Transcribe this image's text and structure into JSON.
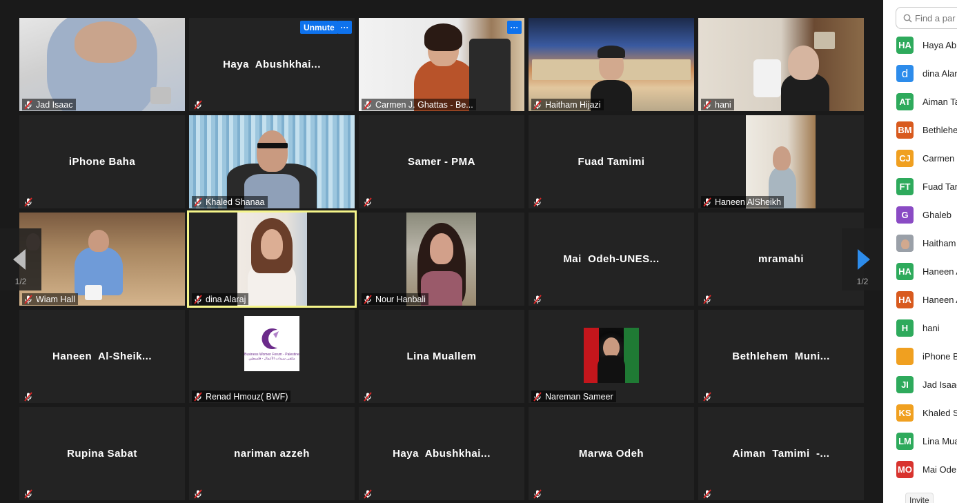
{
  "gallery": {
    "tiles": [
      {
        "name": "Jad Isaac",
        "center": ""
      },
      {
        "name": "",
        "center": "Haya  Abushkhai..."
      },
      {
        "name": "Carmen J. Ghattas - Be...",
        "center": ""
      },
      {
        "name": "Haitham Hijazi",
        "center": ""
      },
      {
        "name": "hani",
        "center": ""
      },
      {
        "name": "",
        "center": "iPhone Baha"
      },
      {
        "name": "Khaled Shanaa",
        "center": ""
      },
      {
        "name": "",
        "center": "Samer - PMA"
      },
      {
        "name": "",
        "center": "Fuad Tamimi"
      },
      {
        "name": "Haneen AlSheikh",
        "center": ""
      },
      {
        "name": "Wiam Hall",
        "center": ""
      },
      {
        "name": "dina Alaraj",
        "center": ""
      },
      {
        "name": "Nour Hanbali",
        "center": ""
      },
      {
        "name": "",
        "center": "Mai  Odeh-UNES..."
      },
      {
        "name": "",
        "center": "mramahi"
      },
      {
        "name": "",
        "center": "Haneen  Al-Sheik..."
      },
      {
        "name": "Renad Hmouz( BWF)",
        "center": ""
      },
      {
        "name": "",
        "center": "Lina Muallem"
      },
      {
        "name": "Nareman Sameer",
        "center": ""
      },
      {
        "name": "",
        "center": "Bethlehem  Muni..."
      },
      {
        "name": "",
        "center": "Rupina Sabat"
      },
      {
        "name": "",
        "center": "nariman azzeh"
      },
      {
        "name": "",
        "center": "Haya  Abushkhai..."
      },
      {
        "name": "",
        "center": "Marwa Odeh"
      },
      {
        "name": "",
        "center": "Aiman  Tamimi  -..."
      }
    ],
    "unmute_label": "Unmute",
    "more_label": "···",
    "page_left": "1/2",
    "page_right": "1/2"
  },
  "logo": {
    "line1": "Business Women Forum - Palestine",
    "line2": "ملتقى سيدات الأعمال - فلسطين"
  },
  "panel": {
    "search_placeholder": "Find a par",
    "participants": [
      {
        "initials": "HA",
        "name": "Haya Ab",
        "color": "#2eaa5c"
      },
      {
        "initials": "d",
        "name": "dina Alar",
        "color": "#2d8ceb"
      },
      {
        "initials": "AT",
        "name": "Aiman Ta",
        "color": "#2eaa5c"
      },
      {
        "initials": "BM",
        "name": "Bethlehe",
        "color": "#d85a1e"
      },
      {
        "initials": "CJ",
        "name": "Carmen .",
        "color": "#f0a020"
      },
      {
        "initials": "FT",
        "name": "Fuad Tar",
        "color": "#2eaa5c"
      },
      {
        "initials": "G",
        "name": "Ghaleb",
        "color": "#8a4bc4"
      },
      {
        "initials": "",
        "name": "Haitham",
        "color": "#9aa0a8"
      },
      {
        "initials": "HA",
        "name": "Haneen A",
        "color": "#2eaa5c"
      },
      {
        "initials": "HA",
        "name": "Haneen A",
        "color": "#d85a1e"
      },
      {
        "initials": "H",
        "name": "hani",
        "color": "#2eaa5c"
      },
      {
        "initials": "",
        "name": "iPhone B",
        "color": "#f0a020"
      },
      {
        "initials": "JI",
        "name": "Jad Isaac",
        "color": "#2eaa5c"
      },
      {
        "initials": "KS",
        "name": "Khaled S",
        "color": "#f0a020"
      },
      {
        "initials": "LM",
        "name": "Lina Mua",
        "color": "#2eaa5c"
      },
      {
        "initials": "MO",
        "name": "Mai Ode",
        "color": "#d8332e"
      }
    ],
    "invite_label": "Invite"
  }
}
